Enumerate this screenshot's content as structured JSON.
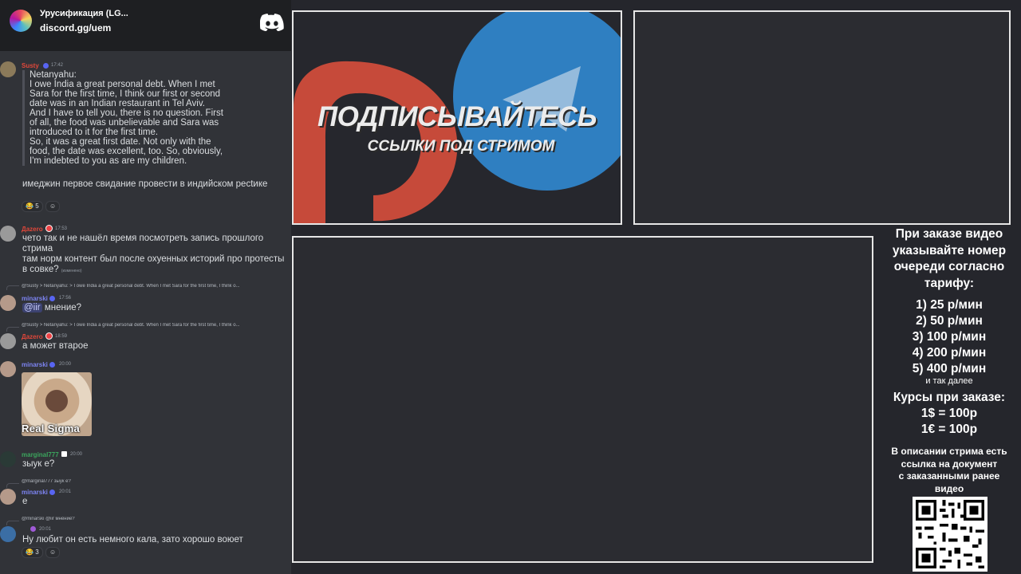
{
  "server": {
    "name": "Урусификация (LG...",
    "invite": "discord.gg/uem"
  },
  "chat": {
    "messages": [
      {
        "author": "Susty",
        "author_color": "#e0473a",
        "time": "17:42",
        "quote": "Netanyahu:\nI owe India a great personal debt. When I met\nSara for the first time, I think our first or second\ndate was in an Indian restaurant in Tel Aviv.\nAnd I have to tell you, there is no question. First\nof all, the food was unbelievable and Sara was\nintroduced to it for the first time.\nSo, it was a great first date. Not only with the\nfood, the date was excellent, too. So, obviously,\nI'm indebted to you as are my children.",
        "text": "имеджин первое свидание провести в индийском ресtике",
        "reactions": [
          {
            "emoji": "😂",
            "count": "5"
          },
          {
            "emoji": "☺",
            "count": ""
          }
        ]
      },
      {
        "author": "Дazero",
        "author_color": "#e0473a",
        "time": "17:53",
        "text1": "чето так и не нашёл время посмотреть запись прошлого стрима",
        "text2": "там норм контент был после охуенных историй про протесты в совке?",
        "edited": "(изменено)"
      },
      {
        "reply_to": "@Susty > Netanyahu: > I owe India a great personal debt. When I met Sara for the first time, I think o...",
        "author": "minarski",
        "author_color": "#7c83f0",
        "time": "17:56",
        "mention": "@iir",
        "text": "мнение?"
      },
      {
        "reply_to": "@Susty > Netanyahu: > I owe India a great personal debt. When I met Sara for the first time, I think o...",
        "author": "Дazero",
        "author_color": "#e0473a",
        "time": "18:59",
        "text": "а может втарое"
      },
      {
        "author": "minarski",
        "author_color": "#7c83f0",
        "time": "20:00",
        "gif_caption": "Real Sigma"
      },
      {
        "author": "marginal777",
        "author_color": "#3ba55d",
        "time": "20:00",
        "text": "зыук е?"
      },
      {
        "reply_to": "@marginal777 зыук е?",
        "author": "minarski",
        "author_color": "#7c83f0",
        "time": "20:01",
        "text": "е"
      },
      {
        "reply_to": "@minarski @iir мнение?",
        "author": "",
        "time": "20:01",
        "text": "Ну любит он есть немного кала, зато хорошо воюет",
        "reactions": [
          {
            "emoji": "😂",
            "count": "3"
          },
          {
            "emoji": "☺",
            "count": ""
          }
        ]
      }
    ]
  },
  "promo": {
    "title": "ПОДПИСЫВАЙТЕСЬ",
    "subtitle": "ССЫЛКИ ПОД СТРИМОМ",
    "colors": {
      "patreon": "#c64a3a",
      "telegram": "#2f7fc1"
    }
  },
  "info": {
    "head": [
      "При заказе видео",
      "указывайте номер",
      "очереди согласно",
      "тарифу:"
    ],
    "tariffs": [
      "1) 25 р/мин",
      "2) 50 р/мин",
      "3) 100 р/мин",
      "4) 200 р/мин",
      "5) 400 р/мин"
    ],
    "tariff_more": "и так далее",
    "rates_title": "Курсы при заказе:",
    "rates": [
      "1$ = 100р",
      "1€ = 100р"
    ],
    "desc": [
      "В описании стрима есть",
      "ссылка на документ",
      "с заказанными ранее",
      "видео"
    ]
  }
}
